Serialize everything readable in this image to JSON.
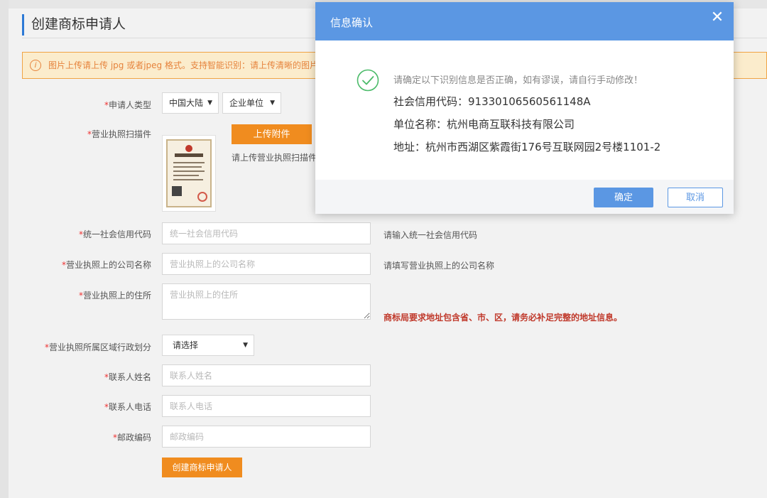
{
  "page": {
    "title": "创建商标申请人",
    "notice": "图片上传请上传 jpg 或者jpeg 格式。支持智能识别：请上传清晰的图片",
    "colors": {
      "accent": "#5b97e3",
      "orange": "#f08c1f",
      "warning": "#c0392b",
      "title_bar": "#2d7ad6"
    }
  },
  "form": {
    "applicant_type": {
      "star": "*",
      "label": "申请人类型",
      "region": "中国大陆",
      "kind": "企业单位"
    },
    "license_scan": {
      "star": "*",
      "label": "营业执照扫描件",
      "upload_label": "上传附件",
      "hint": "请上传营业执照扫描件"
    },
    "credit_code": {
      "star": "*",
      "label": "统一社会信用代码",
      "placeholder": "统一社会信用代码",
      "hint": "请输入统一社会信用代码"
    },
    "company_name": {
      "star": "*",
      "label": "营业执照上的公司名称",
      "placeholder": "营业执照上的公司名称",
      "hint": "请填写营业执照上的公司名称"
    },
    "address": {
      "star": "*",
      "label": "营业执照上的住所",
      "placeholder": "营业执照上的住所",
      "warning": "商标局要求地址包含省、市、区，请务必补足完整的地址信息。"
    },
    "district": {
      "star": "*",
      "label": "营业执照所属区域行政划分",
      "value": "请选择"
    },
    "contact_name": {
      "star": "*",
      "label": "联系人姓名",
      "placeholder": "联系人姓名"
    },
    "contact_phone": {
      "star": "*",
      "label": "联系人电话",
      "placeholder": "联系人电话"
    },
    "postcode": {
      "star": "*",
      "label": "邮政编码",
      "placeholder": "邮政编码"
    },
    "submit_label": "创建商标申请人"
  },
  "dialog": {
    "title": "信息确认",
    "close": "✕",
    "message": "请确定以下识别信息是否正确，如有谬误，请自行手动修改！",
    "credit_code_line": "社会信用代码：91330106560561148A",
    "company_line": "单位名称：杭州电商互联科技有限公司",
    "address_line": "地址：杭州市西湖区紫霞街176号互联网园2号楼1101-2",
    "ok_label": "确定",
    "cancel_label": "取消",
    "icon": "check-circle-icon"
  }
}
